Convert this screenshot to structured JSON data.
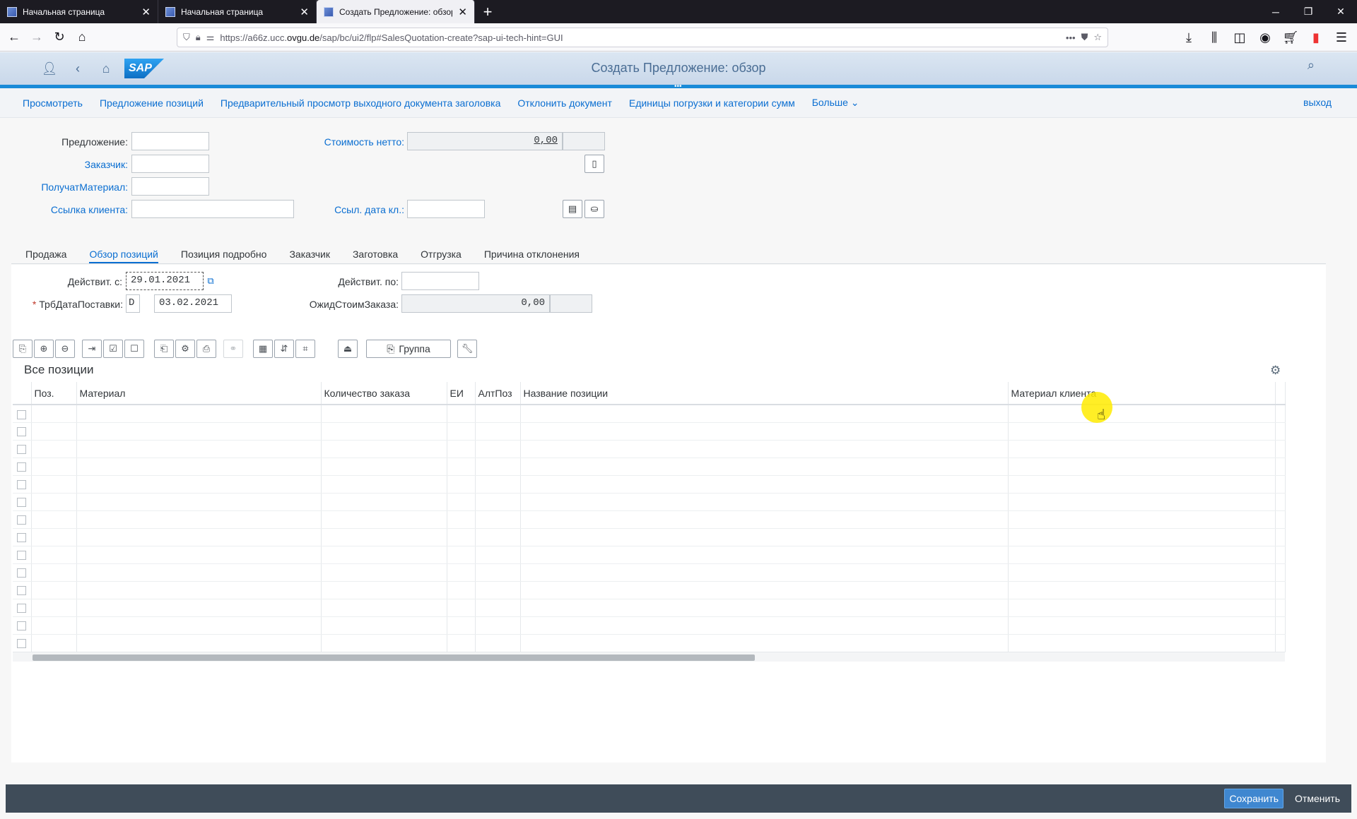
{
  "browser": {
    "tabs": [
      {
        "label": "Начальная страница"
      },
      {
        "label": "Начальная страница"
      },
      {
        "label": "Создать Предложение: обзор"
      }
    ],
    "url_prefix": "https://a66z.ucc.",
    "url_domain": "ovgu.de",
    "url_path": "/sap/bc/ui2/flp#SalesQuotation-create?sap-ui-tech-hint=GUI"
  },
  "shell": {
    "logo": "SAP",
    "title": "Создать Предложение: обзор"
  },
  "toolbar": {
    "items": [
      "Просмотреть",
      "Предложение позиций",
      "Предварительный просмотр выходного документа заголовка",
      "Отклонить документ",
      "Единицы погрузки и категории сумм",
      "Больше"
    ],
    "exit": "выход"
  },
  "header": {
    "quotation_label": "Предложение:",
    "quotation_value": "",
    "customer_label": "Заказчик:",
    "customer_value": "",
    "receiver_label": "ПолучатМатериал:",
    "receiver_value": "",
    "client_ref_label": "Ссылка клиента:",
    "client_ref_value": "",
    "net_value_label": "Стоимость нетто:",
    "net_value": "0,00",
    "net_currency": "",
    "ref_date_label": "Ссыл. дата кл.:",
    "ref_date_value": ""
  },
  "tabs": [
    "Продажа",
    "Обзор позиций",
    "Позиция подробно",
    "Заказчик",
    "Заготовка",
    "Отгрузка",
    "Причина отклонения"
  ],
  "overview": {
    "valid_from_label": "Действит. с:",
    "valid_from": "29.01.2021",
    "valid_to_label": "Действит. по:",
    "valid_to": "",
    "delivery_date_label": "ТрбДатаПоставки:",
    "delivery_date_type": "D",
    "delivery_date": "03.02.2021",
    "expected_value_label": "ОжидСтоимЗаказа:",
    "expected_value": "0,00",
    "expected_currency": ""
  },
  "table": {
    "group_button": "Группа",
    "title": "Все позиции",
    "columns": [
      "Поз.",
      "Материал",
      "Количество заказа",
      "ЕИ",
      "АлтПоз",
      "Название позиции",
      "Материал клиента"
    ],
    "empty_rows": 14
  },
  "footer": {
    "save": "Сохранить",
    "cancel": "Отменить"
  }
}
